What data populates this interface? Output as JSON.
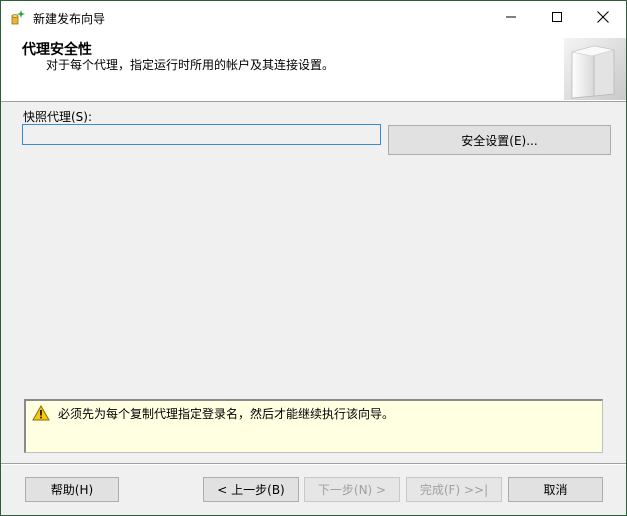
{
  "window": {
    "title": "新建发布向导",
    "controls": {
      "minimize": "minimize-icon",
      "maximize": "maximize-icon",
      "close": "close-icon"
    }
  },
  "header": {
    "title": "代理安全性",
    "subtitle": "对于每个代理，指定运行时所用的帐户及其连接设置。"
  },
  "snapshot_agent": {
    "label": "快照代理(S):",
    "value": "",
    "security_button": "安全设置(E)..."
  },
  "warning": {
    "icon": "warning-icon",
    "message": "必须先为每个复制代理指定登录名，然后才能继续执行该向导。"
  },
  "footer": {
    "help": "帮助(H)",
    "back": "< 上一步(B)",
    "next": "下一步(N) >",
    "finish": "完成(F) >>|",
    "cancel": "取消"
  },
  "colors": {
    "window_border": "#2b5f3a",
    "dialog_bg": "#f0f0f0",
    "input_focus": "#3b8ad6",
    "warning_bg": "#ffffe1",
    "disabled_text": "#a0a0a0"
  }
}
